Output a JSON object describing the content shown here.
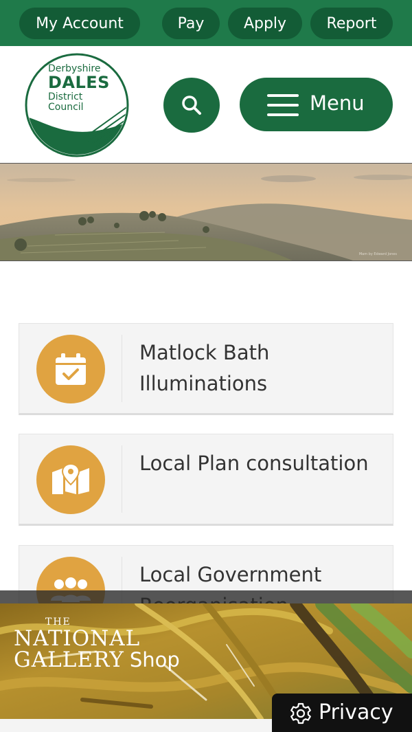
{
  "topbar": {
    "links": [
      "My Account",
      "Pay",
      "Apply",
      "Report"
    ]
  },
  "header": {
    "logo": {
      "line1": "Derbyshire",
      "line2": "DALES",
      "line3": "District",
      "line4": "Council"
    },
    "menu_label": "Menu",
    "search_icon": "search-icon",
    "menu_icon": "hamburger-icon"
  },
  "hero": {
    "credit": "Mam by Edward Jones"
  },
  "cards": [
    {
      "title": "Matlock Bath Illuminations",
      "icon": "calendar-check-icon"
    },
    {
      "title": "Local Plan consultation",
      "icon": "map-pin-icon"
    },
    {
      "title": "Local Government Reorganisation",
      "icon": "people-group-icon"
    }
  ],
  "ad": {
    "the": "THE",
    "national": "NATIONAL",
    "gallery": "GALLERY",
    "shop": "Shop"
  },
  "privacy": {
    "label": "Privacy",
    "icon": "gear-icon"
  },
  "colors": {
    "brand_green": "#1f7a4a",
    "dark_green": "#135c36",
    "accent_orange": "#e0a341"
  }
}
